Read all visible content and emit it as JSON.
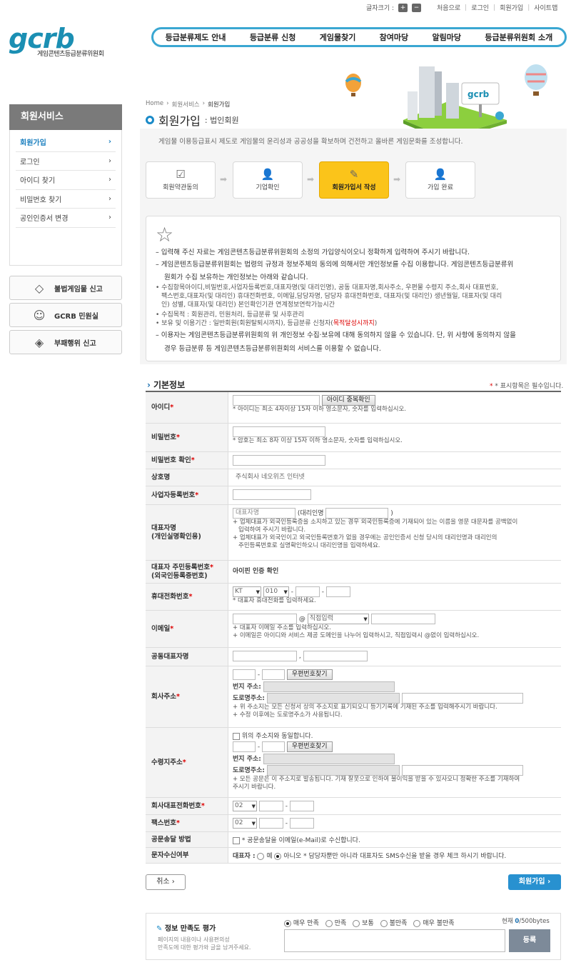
{
  "util": {
    "font_size": "글자크기 :",
    "plus": "+",
    "minus": "−",
    "links": [
      "처음으로",
      "로그인",
      "회원가입",
      "사이트맵"
    ]
  },
  "logo": {
    "mark": "gcrb",
    "name": "게임콘텐츠등급분류위원회"
  },
  "gnb": [
    "등급분류제도 안내",
    "등급분류 신청",
    "게임물찾기",
    "참여마당",
    "알림마당",
    "등급분류위원회 소개"
  ],
  "lnb": {
    "title": "회원서비스",
    "items": [
      "회원가입",
      "로그인",
      "아이디 찾기",
      "비밀번호 찾기",
      "공인인증서 변경"
    ]
  },
  "quick": [
    "불법게임물 신고",
    "GCRB 민원실",
    "부패행위 신고"
  ],
  "breadcrumb": [
    "Home",
    "회원서비스",
    "회원가입"
  ],
  "page": {
    "title": "회원가입",
    "subtitle": "법인회원",
    "intro": "게임물 이용등급표시 제도로 게임물의 윤리성과 공공성을 확보하며 건전하고 올바른 게임문화를 조성합니다."
  },
  "steps": [
    "회원약관동의",
    "기업확인",
    "회원가입서 작성",
    "가입 완료"
  ],
  "notice": {
    "l1": "– 입력해 주신 자료는 게임콘텐츠등급분류위원회의 소정의 가입양식이오니 정확하게 입력하여 주시기 바랍니다.",
    "l2a": "– 게임콘텐츠등급분류위원회는 법령의 규정과 정보주체의 동의에 의해서만 개인정보를 수집 이용합니다. 게임콘텐츠등급분류위",
    "l2b": "원회가 수집 보유하는 개인정보는 아래와 같습니다.",
    "s1a": "• 수집항목아이디,비밀번호,사업자등록번호,대표자명(및 대리인명), 공동 대표자명,회사주소, 우편물 수령지 주소,회사 대표번호,",
    "s1b": "팩스번호,대표자(및 대리인) 휴대전화번호, 이메일,담당자명, 담당자 휴대전화번호, 대표자(및 대리인) 생년월일, 대표자(및 대리",
    "s1c": "인) 성별, 대표자(및 대리인) 본인확인기관 연계정보연락가능시간",
    "s2": "• 수집목적 : 회원관리, 민원처리, 등급분류 및 사후관리",
    "s3a": "• 보유 및 이용기간 : 일반회원(회원탈퇴시까지), 등급분류 신청자(",
    "s3b": "목적달성시까지",
    "s3c": ")",
    "l3a": "– 이용자는 게임콘텐츠등급분류위원회의 위 개인정보 수집·보유에 대해 동의하지 않을 수 있습니다. 단, 위 사항에 동의하지 않을",
    "l3b": "경우 등급분류 등 게임콘텐츠등급분류위원회의 서비스를 이용할 수 없습니다."
  },
  "section": {
    "title": "기본정보",
    "required": "* 표시항목은 필수입니다."
  },
  "form": {
    "id": {
      "label": "아이디",
      "btn": "아이디 중복확인",
      "hint": "* 아이디는 최소 4자이상 15자 이하 영소문자, 숫자를 입력하십시오."
    },
    "pw": {
      "label": "비밀번호",
      "hint": "* 암호는 최소 8자 이상 15자 이하 영소문자, 숫자를 입력하십시오."
    },
    "pw2": {
      "label": "비밀번호 확인"
    },
    "company": {
      "label": "상호명",
      "value": "주식회사 네오위즈 인터넷"
    },
    "bizno": {
      "label": "사업자등록번호"
    },
    "rep": {
      "label1": "대표자명",
      "label2": "(개인실명확인용)",
      "ph": "대표자명",
      "agent": "(대리인명",
      "close": ")",
      "h1a": "+ 업체대표가 외국인등록증을 소지하고 있는 경우 외국인등록증에 기재되어 있는 이름을 영문 대문자를 공백없이",
      "h1b": "입력하여 주시기 바랍니다.",
      "h2a": "+ 업체대표가 외국인이고 외국인등록번호가 없을 경우에는 공인인증서 신청 당시의 대리인명과 대리인의",
      "h2b": "주민등록번호로 실명확인하오니 대리인명을 입력하세요."
    },
    "resid": {
      "label1": "대표자 주민등록번호",
      "label2": "(외국인등록증번호)",
      "value": "아이핀 인증 확인"
    },
    "mobile": {
      "label": "휴대전화번호",
      "carrier": "KT",
      "prefix": "010",
      "dash": "-",
      "hint": "* 대표자 휴대전화를 입력하세요."
    },
    "email": {
      "label": "이메일",
      "at": "@",
      "domain": "직접입력",
      "h1": "+ 대표자 이메일 주소를 입력하십시오.",
      "h2": "+ 이메일은 아이디와 서비스 제공 도메인을 나누어 입력하시고, 직접입력시 @없이 입력하십시오."
    },
    "corep": {
      "label": "공동대표자명",
      "comma": ","
    },
    "addr": {
      "label": "회사주소",
      "btn": "우편번호찾기",
      "lot": "번지  주소:",
      "road": "도로명주소:",
      "h1": "+ 위 주소지는 모든 신청서 상의 주소지로 표기되오니 등기기록에 기재된 주소를 입력해주시기 바랍니다.",
      "h2": "+ 수정 이후에는 도로명주소가 사용됩니다."
    },
    "mail": {
      "label": "수령지주소",
      "same": "위의 주소지와 동일합니다.",
      "btn": "우편번호찾기",
      "lot": "번지  주소:",
      "road": "도로명주소:",
      "h1": "+ 모든 공문은 이 주소지로 발송됩니다. 기재 잘못으로 인하여 불이익을 받을 수 있사오니 정확한 주소를 기재하여",
      "h2": "주시기 바랍니다."
    },
    "tel": {
      "label": "회사대표전화번호",
      "area": "02"
    },
    "fax": {
      "label": "팩스번호",
      "area": "02"
    },
    "send": {
      "label": "공문송달 방법",
      "text": "* 공문송달을 이메일(e-Mail)로 수신합니다."
    },
    "sms": {
      "label": "문자수신여부",
      "rep": "대표자 :",
      "yes": "예",
      "no": "아니오",
      "note": "* 담당자뿐만 아니라 대표자도 SMS수신을 받을 경우 체크 하시기 바랍니다."
    }
  },
  "buttons": {
    "cancel": "취소",
    "join": "회원가입"
  },
  "sat": {
    "title": "정보 만족도 평가",
    "d1": "페이지의 내용이나 사용편의성",
    "d2": "만족도에 대한 평가와 글을 남겨주세요.",
    "opts": [
      "매우 만족",
      "만족",
      "보통",
      "불만족",
      "매우 불만족"
    ],
    "count_label": "현재",
    "count": "0",
    "max": "/500bytes",
    "submit": "등록"
  }
}
